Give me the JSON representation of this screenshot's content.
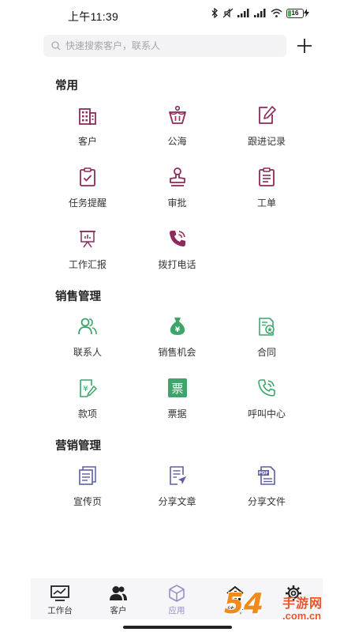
{
  "status_bar": {
    "time": "上午11:39",
    "battery": "16"
  },
  "search": {
    "placeholder": "快速搜索客户，联系人"
  },
  "sections": [
    {
      "title": "常用",
      "items": [
        {
          "label": "客户",
          "icon": "building-icon"
        },
        {
          "label": "公海",
          "icon": "public-pool-icon"
        },
        {
          "label": "跟进记录",
          "icon": "edit-note-icon"
        },
        {
          "label": "任务提醒",
          "icon": "task-clipboard-icon"
        },
        {
          "label": "审批",
          "icon": "stamp-icon"
        },
        {
          "label": "工单",
          "icon": "work-order-icon"
        },
        {
          "label": "工作汇报",
          "icon": "presentation-board-icon"
        },
        {
          "label": "拨打电话",
          "icon": "phone-call-icon"
        }
      ]
    },
    {
      "title": "销售管理",
      "items": [
        {
          "label": "联系人",
          "icon": "contacts-icon"
        },
        {
          "label": "销售机会",
          "icon": "money-bag-icon"
        },
        {
          "label": "合同",
          "icon": "contract-icon"
        },
        {
          "label": "款项",
          "icon": "payment-icon"
        },
        {
          "label": "票据",
          "icon": "invoice-icon",
          "glyph": "票"
        },
        {
          "label": "呼叫中心",
          "icon": "call-center-icon"
        }
      ]
    },
    {
      "title": "营销管理",
      "items": [
        {
          "label": "宣传页",
          "icon": "flyer-icon"
        },
        {
          "label": "分享文章",
          "icon": "share-article-icon"
        },
        {
          "label": "分享文件",
          "icon": "share-file-icon",
          "badge": "PDF"
        }
      ]
    }
  ],
  "bottom_nav": [
    {
      "label": "工作台",
      "icon": "dashboard-icon"
    },
    {
      "label": "客户",
      "icon": "customers-icon"
    },
    {
      "label": "应用",
      "icon": "apps-cube-icon",
      "active": true
    },
    {
      "label": "统计",
      "icon": "statistics-icon"
    },
    {
      "label": "",
      "icon": "settings-icon"
    }
  ],
  "watermark": {
    "brand_num": "54",
    "brand_cn": "手游网",
    "url": ".com.cn"
  },
  "colors": {
    "primary_plum": "#8e2a5c",
    "sales_green": "#3da56a",
    "marketing_indigo": "#5b5ea6",
    "active_nav": "#9b8fc8"
  }
}
